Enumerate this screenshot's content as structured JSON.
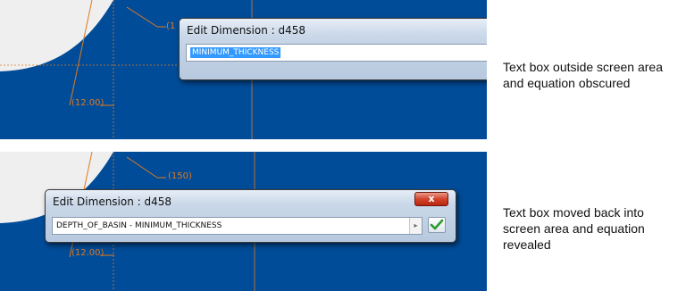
{
  "top_panel": {
    "dimension_labels": [
      "(1",
      "(12.00)"
    ],
    "dialog": {
      "title": "Edit Dimension : d458",
      "field_value": "MINIMUM_THICKNESS"
    },
    "caption": "Text box outside screen area and equation obscured"
  },
  "bottom_panel": {
    "dimension_labels": [
      "(150)",
      "(12.00)"
    ],
    "dialog": {
      "title": "Edit Dimension : d458",
      "field_value": "DEPTH_OF_BASIN - MINIMUM_THICKNESS",
      "close_label": "x",
      "arrow_glyph": "▸",
      "accept_icon": "check-icon"
    },
    "caption": "Text box moved back into screen area and equation revealed"
  },
  "colors": {
    "background": "#004c99",
    "part_surface": "#efefef",
    "dimension_line": "#e07a1f",
    "selection": "#3399ff",
    "accept": "#2e9a2e"
  }
}
